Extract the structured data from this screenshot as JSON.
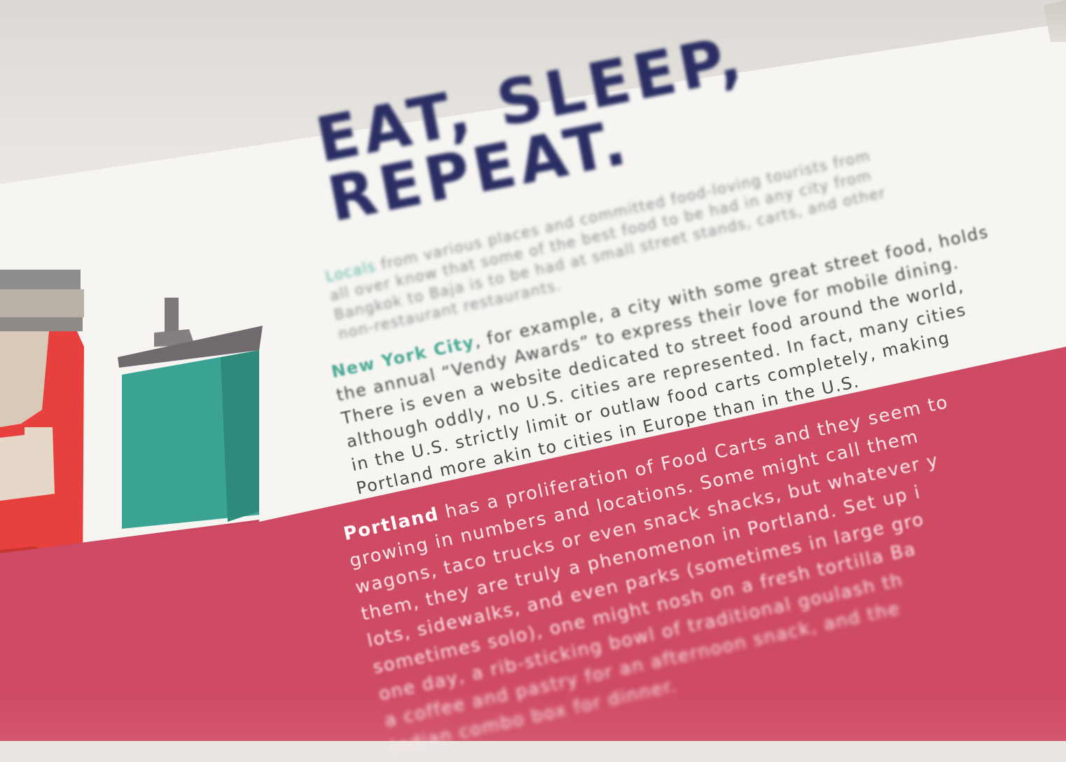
{
  "headline": {
    "line1": "EAT, SLEEP,",
    "line2": "REPEAT."
  },
  "intro": {
    "accent": "Locals",
    "line1_rest": " from various places and committed food-loving tourists from",
    "line2": "all over know that some of the best food to be had in any city from",
    "line3": "Bangkok to Baja is to be had at small street stands, carts, and other",
    "line4": "non-restaurant restaurants."
  },
  "nyc": {
    "accent": "New York City",
    "line1_rest": ", for example, a city with some great street food, holds",
    "line2": "the annual “Vendy Awards” to express their love for mobile dining.",
    "line3": "There is even a website dedicated to street food around the world,",
    "line4": "although oddly, no U.S. cities are represented. In fact, many cities",
    "line5": "in the U.S. strictly limit or outlaw food carts completely, making",
    "line6": "Portland more akin to cities in Europe than in the U.S."
  },
  "portland": {
    "lead": "Portland",
    "line1_rest": " has a proliferation of Food Carts and they seem to",
    "line2": "growing in numbers and locations. Some might call them",
    "line3": "wagons, taco trucks or even snack shacks, but whatever y",
    "line4": "them, they are truly a phenomenon in Portland. Set up i",
    "line5": "lots, sidewalks, and even parks (sometimes in large gro",
    "line6": "sometimes solo), one might nosh on a fresh tortilla Ba",
    "line7": "one day, a rib-sticking bowl of traditional goulash th",
    "line8": "a coffee and pastry for an afternoon snack, and the",
    "line9": "Indian combo box for dinner."
  },
  "colors": {
    "navy": "#2a2e63",
    "teal": "#55b3a0",
    "pink": "#cf4a63",
    "red": "#e8413d"
  }
}
